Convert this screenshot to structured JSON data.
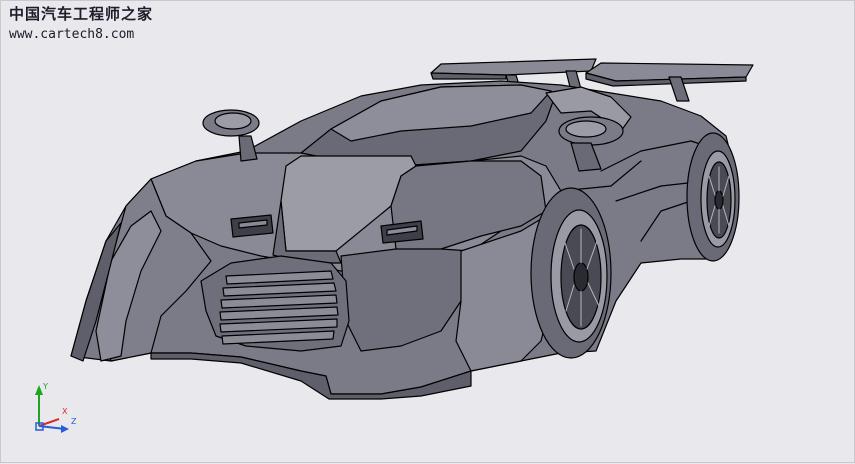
{
  "watermark": {
    "site_name": "中国汽车工程师之家",
    "url": "www.cartech8.com"
  },
  "ucs": {
    "x_label": "X",
    "y_label": "Y",
    "z_label": "Z",
    "colors": {
      "x": "#d23030",
      "y": "#1ea51e",
      "z": "#2a5bd8"
    }
  },
  "viewport": {
    "background": "#e9e8ec",
    "model_fill": "#7b7b88",
    "model_shadow": "#5f5f6b",
    "model_light": "#a3a3ad",
    "edge_color": "#000000"
  }
}
